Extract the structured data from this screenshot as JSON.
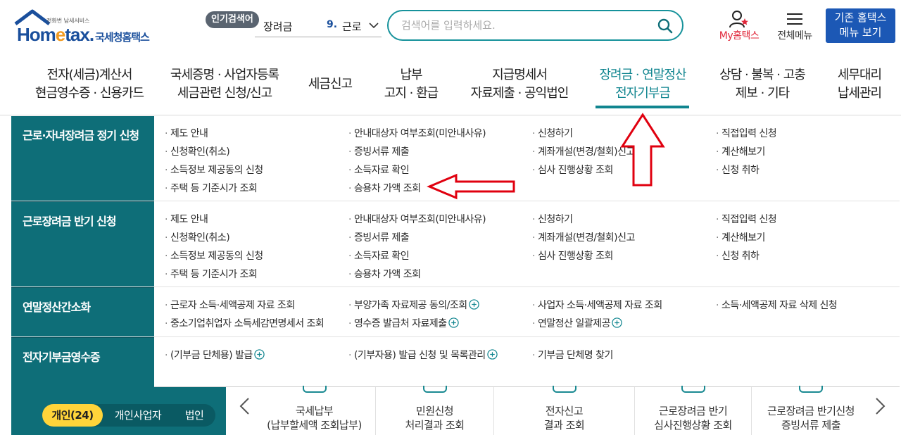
{
  "header": {
    "logo_sub": "전화번 납세서비스",
    "logo_main_a": "Hom",
    "logo_main_dot": "e",
    "logo_main_b": "tax.",
    "logo_kr": "국세청홈택스",
    "popular_badge": "인기검색어",
    "popular_term": "장려금",
    "popular_rank": "9.",
    "popular_rank_word": "근로",
    "search_placeholder": "검색어를 입력하세요.",
    "my_hometax": "My홈택스",
    "all_menu": "전체메뉴",
    "old_menu_line1": "기존 홈택스",
    "old_menu_line2": "메뉴 보기"
  },
  "gnb": [
    {
      "line1": "전자(세금)계산서",
      "line2": "현금영수증 · 신용카드"
    },
    {
      "line1": "국세증명 · 사업자등록",
      "line2": "세금관련 신청/신고"
    },
    {
      "line1": "세금신고",
      "line2": ""
    },
    {
      "line1": "납부",
      "line2": "고지 · 환급"
    },
    {
      "line1": "지급명세서",
      "line2": "자료제출 · 공익법인"
    },
    {
      "line1": "장려금 · 연말정산",
      "line2": "전자기부금"
    },
    {
      "line1": "상담 · 불복 · 고충",
      "line2": "제보 · 기타"
    },
    {
      "line1": "세무대리",
      "line2": "납세관리"
    }
  ],
  "mega": {
    "categories": [
      {
        "title": "근로·자녀장려금 정기 신청",
        "links": [
          [
            "제도 안내",
            "안내대상자 여부조회(미안내사유)",
            "신청하기",
            "직접입력 신청"
          ],
          [
            "신청확인(취소)",
            "증빙서류 제출",
            "계좌개설(변경/철회)신고",
            "계산해보기"
          ],
          [
            "소득정보 제공동의 신청",
            "소득자료 확인",
            "심사 진행상황 조회",
            "신청 취하"
          ],
          [
            "주택 등 기준시가 조회",
            "승용차 가액 조회",
            "",
            ""
          ]
        ]
      },
      {
        "title": "근로장려금 반기 신청",
        "links": [
          [
            "제도 안내",
            "안내대상자 여부조회(미안내사유)",
            "신청하기",
            "직접입력 신청"
          ],
          [
            "신청확인(취소)",
            "증빙서류 제출",
            "계좌개설(변경/철회)신고",
            "계산해보기"
          ],
          [
            "소득정보 제공동의 신청",
            "소득자료 확인",
            "심사 진행상황 조회",
            "신청 취하"
          ],
          [
            "주택 등 기준시가 조회",
            "승용차 가액 조회",
            "",
            ""
          ]
        ]
      },
      {
        "title": "연말정산간소화",
        "links": [
          [
            "근로자 소득·세액공제 자료 조회",
            "부양가족 자료제공 동의/조회",
            "사업자 소득·세액공제 자료 조회",
            "소득·세액공제 자료 삭제 신청"
          ],
          [
            "중소기업취업자 소득세감면명세서 조회",
            "영수증 발급처 자료제출",
            "연말정산 일괄제공",
            ""
          ]
        ]
      },
      {
        "title": "전자기부금영수증",
        "links": [
          [
            "(기부금 단체용) 발급",
            "(기부자용) 발급 신청 및 목록관리",
            "기부금 단체명 찾기",
            ""
          ]
        ]
      }
    ]
  },
  "bottom": {
    "tabs": [
      "개인(24)",
      "개인사업자",
      "법인"
    ],
    "quick": [
      {
        "line1": "국세납부",
        "line2": "(납부할세액 조회납부)"
      },
      {
        "line1": "민원신청",
        "line2": "처리결과 조회"
      },
      {
        "line1": "전자신고",
        "line2": "결과 조회"
      },
      {
        "line1": "근로장려금 반기",
        "line2": "심사진행상황 조회"
      },
      {
        "line1": "근로장려금 반기신청",
        "line2": "증빙서류 제출"
      }
    ]
  },
  "colors": {
    "teal": "#0e6e78",
    "active_menu": "#10858f",
    "brand_blue": "#1c58b5",
    "annotation_red": "#e0000f",
    "tab_active": "#ffd43a"
  },
  "icons": [
    "search-icon",
    "user-star-icon",
    "hamburger-icon",
    "plus-circle-icon",
    "chevron-left-icon",
    "chevron-right-icon",
    "chevron-down-icon"
  ]
}
